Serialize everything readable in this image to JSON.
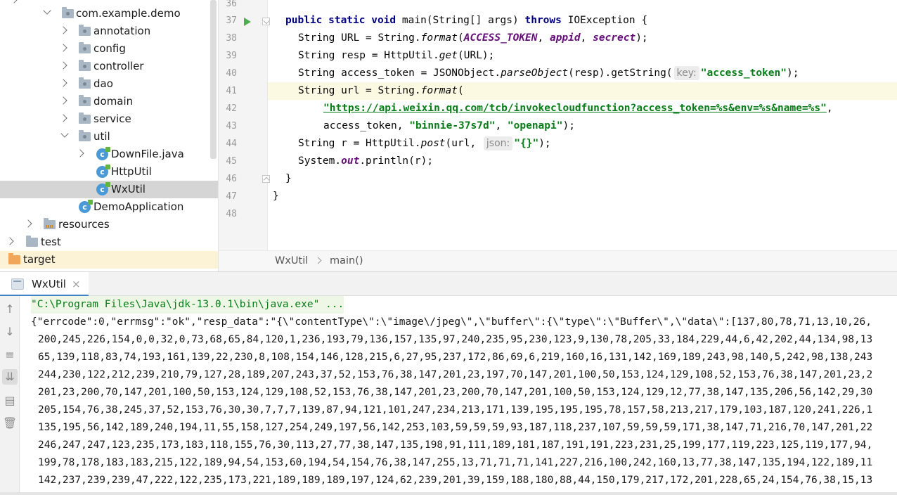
{
  "project_tree": {
    "items": [
      {
        "label": "com.example.demo",
        "kind": "package",
        "state": "expanded"
      },
      {
        "label": "annotation",
        "kind": "package",
        "state": "collapsed"
      },
      {
        "label": "config",
        "kind": "package",
        "state": "collapsed"
      },
      {
        "label": "controller",
        "kind": "package",
        "state": "collapsed"
      },
      {
        "label": "dao",
        "kind": "package",
        "state": "collapsed"
      },
      {
        "label": "domain",
        "kind": "package",
        "state": "collapsed"
      },
      {
        "label": "service",
        "kind": "package",
        "state": "collapsed"
      },
      {
        "label": "util",
        "kind": "package",
        "state": "expanded"
      },
      {
        "label": "DownFile.java",
        "kind": "java-file",
        "state": "collapsed"
      },
      {
        "label": "HttpUtil",
        "kind": "class",
        "state": "leaf"
      },
      {
        "label": "WxUtil",
        "kind": "class",
        "state": "selected"
      },
      {
        "label": "DemoApplication",
        "kind": "class",
        "state": "leaf"
      },
      {
        "label": "resources",
        "kind": "resources-folder",
        "state": "collapsed"
      },
      {
        "label": "test",
        "kind": "folder",
        "state": "collapsed"
      },
      {
        "label": "target",
        "kind": "excluded-folder",
        "state": "highlighted"
      }
    ]
  },
  "editor": {
    "line_numbers": [
      "36",
      "37",
      "38",
      "39",
      "40",
      "41",
      "42",
      "43",
      "44",
      "45",
      "46",
      "47",
      "48"
    ],
    "current_line": "41",
    "code": {
      "l37": {
        "kw1": "public static void ",
        "name": "main(String[] args) ",
        "kw2": "throws ",
        "rest": "IOException {"
      },
      "l38": {
        "pre": "String URL = String.",
        "fn": "format",
        "open": "(",
        "c1": "ACCESS_TOKEN",
        "sep1": ", ",
        "c2": "appid",
        "sep2": ", ",
        "c3": "secrect",
        "close": ");"
      },
      "l39": {
        "pre": "String resp = HttpUtil.",
        "fn": "get",
        "rest": "(URL);"
      },
      "l40": {
        "pre": "String access_token = JSONObject.",
        "fn": "parseObject",
        "mid": "(resp).getString(",
        "hint": "key:",
        "str": "\"access_token\"",
        "close": ");"
      },
      "l41": {
        "pre": "String url = String.",
        "fn": "format",
        "open": "("
      },
      "l42": {
        "url": "\"https://api.weixin.qq.com/tcb/invokecloudfunction?access_token=%s&env=%s&name=%s\"",
        "rest": ","
      },
      "l43": {
        "pre": "access_token, ",
        "s1": "\"binnie-37s7d\"",
        "sep": ", ",
        "s2": "\"openapi\"",
        "close": ");"
      },
      "l44": {
        "pre": "String r = HttpUtil.",
        "fn": "post",
        "mid": "(url, ",
        "hint": "json:",
        "str": "\"{}\"",
        "close": ");"
      },
      "l45": {
        "pre": "System.",
        "field": "out",
        "rest": ".println(r);"
      },
      "l46": {
        "text": "}"
      },
      "l47": {
        "text": "}"
      }
    },
    "breadcrumb": [
      "WxUtil",
      "main()"
    ]
  },
  "run_panel": {
    "tab_label": "WxUtil",
    "close_glyph": "×",
    "toolbar_icons": [
      "up-arrow-icon",
      "down-arrow-icon",
      "soft-wrap-icon",
      "scroll-to-end-icon",
      "print-icon",
      "trash-icon"
    ],
    "console_lines": [
      "\"C:\\Program Files\\Java\\jdk-13.0.1\\bin\\java.exe\" ...",
      "{\"errcode\":0,\"errmsg\":\"ok\",\"resp_data\":\"{\\\"contentType\\\":\\\"image\\/jpeg\\\",\\\"buffer\\\":{\\\"type\\\":\\\"Buffer\\\",\\\"data\\\":[137,80,78,71,13,10,26,",
      "200,245,226,154,0,0,32,0,73,68,65,84,120,1,236,193,79,136,157,135,97,240,235,95,230,123,9,130,78,205,33,184,229,44,6,42,202,44,134,98,13",
      "65,139,118,83,74,193,161,139,22,230,8,108,154,146,128,215,6,27,95,237,172,86,69,6,219,160,16,131,142,169,189,243,98,140,5,242,98,138,243",
      "244,230,122,212,239,210,79,127,28,189,207,243,37,52,153,76,38,147,201,23,197,70,147,201,100,50,153,124,129,108,52,153,76,38,147,201,23,2",
      "201,23,200,70,147,201,100,50,153,124,129,108,52,153,76,38,147,201,23,200,70,147,201,100,50,153,124,129,12,77,38,147,135,206,56,142,29,30",
      "205,154,76,38,245,37,52,153,76,30,30,7,7,7,139,87,94,121,101,247,234,213,171,139,195,195,195,78,157,58,213,217,179,103,187,120,241,226,1",
      "135,195,56,142,189,240,194,11,55,158,127,254,249,197,56,142,253,103,59,59,59,93,187,118,237,107,59,59,59,171,38,147,71,216,70,147,201,22",
      "246,247,247,123,235,173,183,118,155,76,30,113,27,77,38,147,135,198,91,111,189,181,187,191,191,223,231,25,199,177,119,223,125,119,177,94,",
      "199,78,178,183,183,215,122,189,94,54,153,60,194,54,154,76,38,147,255,13,71,71,71,141,227,216,100,242,160,13,77,38,147,135,194,122,189,11",
      "142,237,239,239,47,222,122,235,173,221,189,189,189,197,124,62,239,201,39,159,188,180,88,44,150,179,217,172,201,228,65,24,154,76,38,15,13"
    ]
  }
}
